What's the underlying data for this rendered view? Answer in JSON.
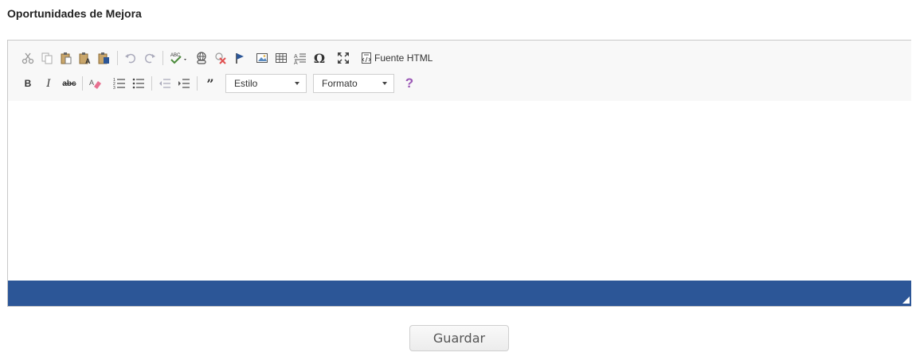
{
  "section": {
    "title": "Oportunidades de Mejora"
  },
  "toolbar": {
    "source_label": "Fuente HTML",
    "style_combo": "Estilo",
    "format_combo": "Formato",
    "help_glyph": "?",
    "omega_glyph": "Ω"
  },
  "actions": {
    "save_label": "Guardar"
  },
  "colors": {
    "bottom_bar": "#2c5697",
    "help": "#9b59b6",
    "link_red": "#e05050"
  }
}
